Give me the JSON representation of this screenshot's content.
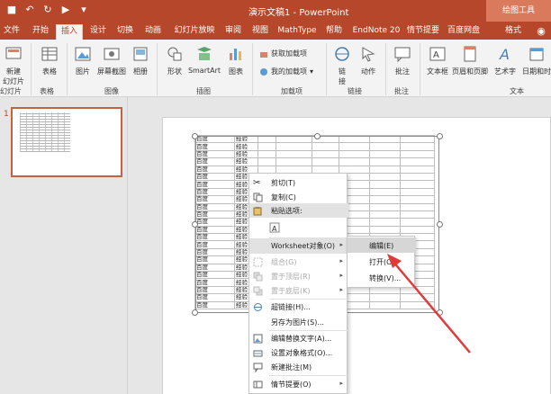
{
  "titlebar": {
    "doc_title": "演示文稿1 - PowerPoint",
    "contextual_tab": "绘图工具"
  },
  "tabs": [
    "文件",
    "开始",
    "插入",
    "设计",
    "切换",
    "动画",
    "幻灯片放映",
    "审阅",
    "视图",
    "MathType",
    "帮助",
    "EndNote 20",
    "情节提要",
    "百度网盘",
    "格式"
  ],
  "ribbon": {
    "new_slide": "新建\n幻灯片",
    "new_slide_label1": "新建",
    "new_slide_label2": "幻灯片",
    "table": "表格",
    "picture": "图片",
    "screenshot": "屏幕截图",
    "album": "相册",
    "shapes": "形状",
    "smartart": "SmartArt",
    "chart": "图表",
    "get_addins": "获取加载项",
    "my_addins": "我的加载项",
    "link": "链",
    "link2": "接",
    "action": "动作",
    "comment": "批注",
    "textbox": "文本框",
    "header_footer": "页眉和页脚",
    "wordart": "艺术字",
    "datetime": "日期和时",
    "groups": {
      "slides": "幻灯片",
      "tables": "表格",
      "images": "图像",
      "illustrations": "插图",
      "addins": "加载项",
      "links": "链接",
      "comments": "批注",
      "text": "文本"
    }
  },
  "slide_number": "1",
  "sheet": {
    "col_a": "百度",
    "col_b": "经验"
  },
  "context_menu": {
    "cut": "剪切(T)",
    "copy": "复制(C)",
    "paste_options": "粘贴选项:",
    "worksheet_object": "Worksheet对象(O)",
    "group": "组合(G)",
    "bring_front": "置于顶层(R)",
    "send_back": "置于底层(K)",
    "hyperlink": "超链接(H)...",
    "save_as_picture": "另存为图片(S)...",
    "alt_text": "编辑替换文字(A)...",
    "format_object": "设置对象格式(O)...",
    "new_comment": "新建批注(M)",
    "storyboard": "情节提要(O)"
  },
  "submenu": {
    "edit": "编辑(E)",
    "open": "打开(O)",
    "convert": "转换(V)..."
  },
  "colors": {
    "accent": "#b7472a",
    "annotation_arrow": "#e03a3a"
  }
}
